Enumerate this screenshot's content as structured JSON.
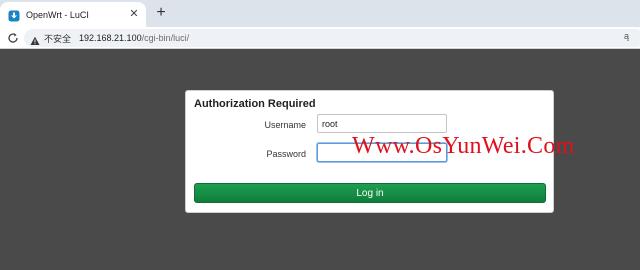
{
  "browser": {
    "tab": {
      "title": "OpenWrt - LuCI",
      "favicon": "openwrt-favicon",
      "close_glyph": "✕"
    },
    "new_tab_glyph": "+",
    "address_bar": {
      "security_label": "不安全",
      "url_host": "192.168.21.100",
      "url_path": "/cgi-bin/luci/",
      "right_glyph": "ą"
    }
  },
  "login": {
    "title": "Authorization Required",
    "username_label": "Username",
    "username_value": "root",
    "password_label": "Password",
    "password_value": "",
    "submit_label": "Log in"
  },
  "watermark": "Www.OsYunWei.Com",
  "colors": {
    "page_background": "#4a4a4a",
    "button_green": "#0f7e3b",
    "watermark_red": "#e0101c"
  }
}
